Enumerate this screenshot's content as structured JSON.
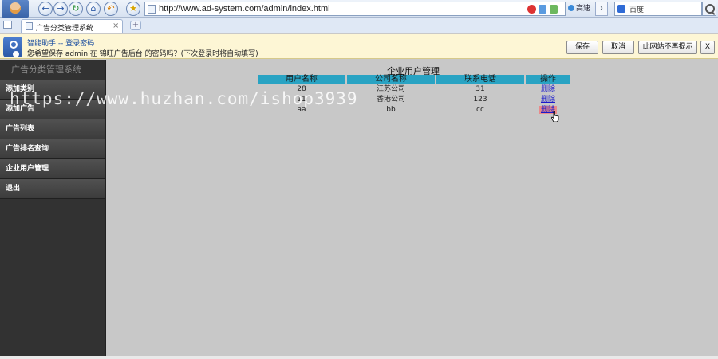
{
  "browser": {
    "url": "http://www.ad-system.com/admin/index.html",
    "speed_label": "高速",
    "search_placeholder": "百度",
    "tab_title": "广告分类管理系统"
  },
  "notify": {
    "title": "智能助手 -- 登录密码",
    "message": "您希望保存 admin 在 锦旺广告后台 的密码吗？(下次登录时将自动填写)",
    "save_label": "保存",
    "cancel_label": "取消",
    "never_label": "此网站不再提示",
    "close_label": "X"
  },
  "sidebar": {
    "brand": "广告分类管理系统",
    "items": [
      {
        "label": "添加类别"
      },
      {
        "label": "添加广告"
      },
      {
        "label": "广告列表"
      },
      {
        "label": "广告排名查询"
      },
      {
        "label": "企业用户管理"
      },
      {
        "label": "退出"
      }
    ]
  },
  "main": {
    "table_title": "企业用户管理",
    "columns": [
      "用户名称",
      "公司名称",
      "联系电话",
      "操作"
    ],
    "rows": [
      {
        "username": "28",
        "company": "江苏公司",
        "phone": "31",
        "action": "删除"
      },
      {
        "username": "11",
        "company": "香港公司",
        "phone": "123",
        "action": "删除"
      },
      {
        "username": "aa",
        "company": "bb",
        "phone": "cc",
        "action": "删除"
      }
    ]
  },
  "watermark": "https://www.huzhan.com/ishop3939"
}
